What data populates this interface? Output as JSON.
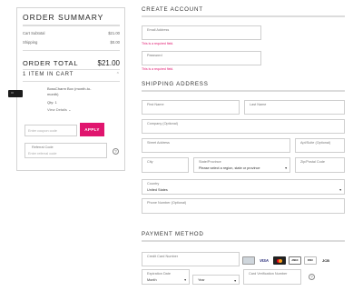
{
  "summary": {
    "title": "ORDER SUMMARY",
    "cart_subtotal_label": "Cart Subtotal",
    "cart_subtotal_value": "$21.00",
    "shipping_label": "Shipping",
    "shipping_value": "$0.00",
    "order_total_label": "ORDER TOTAL",
    "order_total_value": "$21.00",
    "items_in_cart": "1 ITEM IN CART",
    "product": {
      "name_line1": "BossCharm Box (month-to-",
      "name_line2": "month)",
      "qty": "Qty: 1",
      "details_link": "View Details"
    },
    "coupon": {
      "placeholder": "Enter coupon code",
      "apply_label": "APPLY"
    },
    "referral": {
      "label": "Referral Code",
      "placeholder": "Enter referral code"
    }
  },
  "account": {
    "title": "CREATE ACCOUNT",
    "email_label": "Email Address",
    "email_error": "This is a required field.",
    "password_label": "Password",
    "password_error": "This is a required field."
  },
  "shipping": {
    "title": "SHIPPING ADDRESS",
    "first_name": "First Name",
    "last_name": "Last Name",
    "company": "Company (Optional)",
    "street": "Street Address",
    "apt": "Apt/Suite (Optional)",
    "city": "City",
    "state_label": "State/Province",
    "state_value": "Please select a region, state or province",
    "zip": "Zip/Postal Code",
    "country_label": "Country",
    "country_value": "United States",
    "phone": "Phone Number (Optional)"
  },
  "payment": {
    "title": "PAYMENT METHOD",
    "card_number": "Credit Card Number",
    "expiration_label": "Expiration Date",
    "month_value": "Month",
    "year_value": "Year",
    "cvv_label": "Card Verification Number",
    "cards": [
      "generic-card-icon",
      "visa-icon",
      "mastercard-icon",
      "amex-icon",
      "discover-icon",
      "jcb-icon"
    ]
  },
  "colors": {
    "accent": "#e0156e",
    "rule": "#dcdcdc",
    "border": "#cfcfcf"
  }
}
